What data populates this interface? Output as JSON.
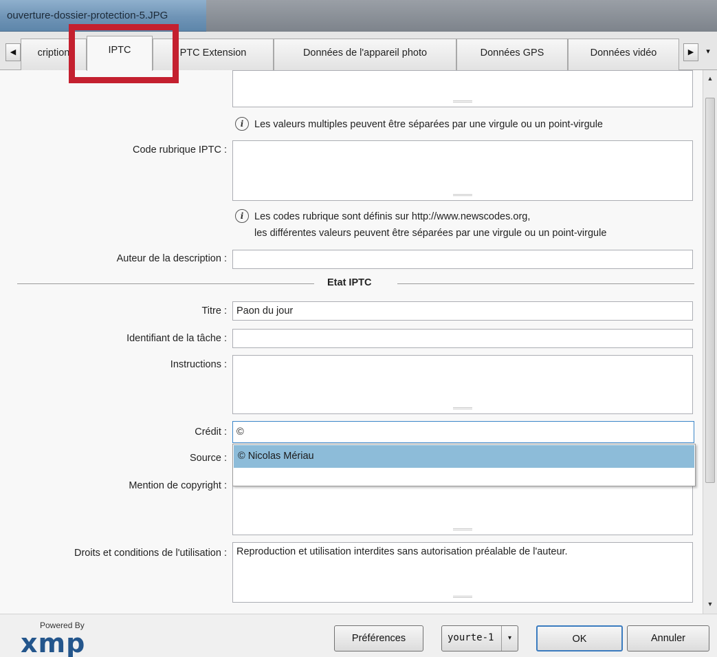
{
  "window": {
    "title": "ouverture-dossier-protection-5.JPG"
  },
  "tabs": {
    "prev_arrow": "◀",
    "next_arrow": "▶",
    "menu_arrow": "▾",
    "items": [
      {
        "label": "cription"
      },
      {
        "label": "IPTC",
        "active": true
      },
      {
        "label": "PTC Extension"
      },
      {
        "label": "Données de l'appareil photo"
      },
      {
        "label": "Données GPS"
      },
      {
        "label": "Données vidéo"
      }
    ]
  },
  "highlight_color": "#c4202f",
  "form": {
    "info_multi": "Les valeurs multiples peuvent être séparées par une virgule ou un point-virgule",
    "code_rubrique_label": "Code rubrique IPTC :",
    "code_rubrique_value": "",
    "info_codes_line1": "Les codes rubrique sont définis sur http://www.newscodes.org,",
    "info_codes_line2": "les différentes valeurs peuvent être séparées par une virgule ou un point-virgule",
    "auteur_label": "Auteur de la description :",
    "auteur_value": "",
    "section_title": "Etat IPTC",
    "titre_label": "Titre :",
    "titre_value": "Paon du jour",
    "identifiant_label": "Identifiant de la tâche :",
    "identifiant_value": "",
    "instructions_label": "Instructions :",
    "instructions_value": "",
    "credit_label": "Crédit :",
    "credit_value": "©",
    "source_label": "Source :",
    "copyright_label": "Mention de copyright :",
    "droits_label": "Droits et conditions de l'utilisation :",
    "droits_value": "Reproduction et utilisation interdites sans autorisation préalable de l'auteur.",
    "autocomplete_option": "© Nicolas Mériau",
    "info_icon_glyph": "i"
  },
  "footer": {
    "powered_by": "Powered By",
    "logo": "xmp",
    "preferences": "Préférences",
    "template_value": "yourte-1",
    "template_arrow": "▾",
    "ok": "OK",
    "cancel": "Annuler"
  },
  "scroll_up": "▲",
  "scroll_down": "▼"
}
